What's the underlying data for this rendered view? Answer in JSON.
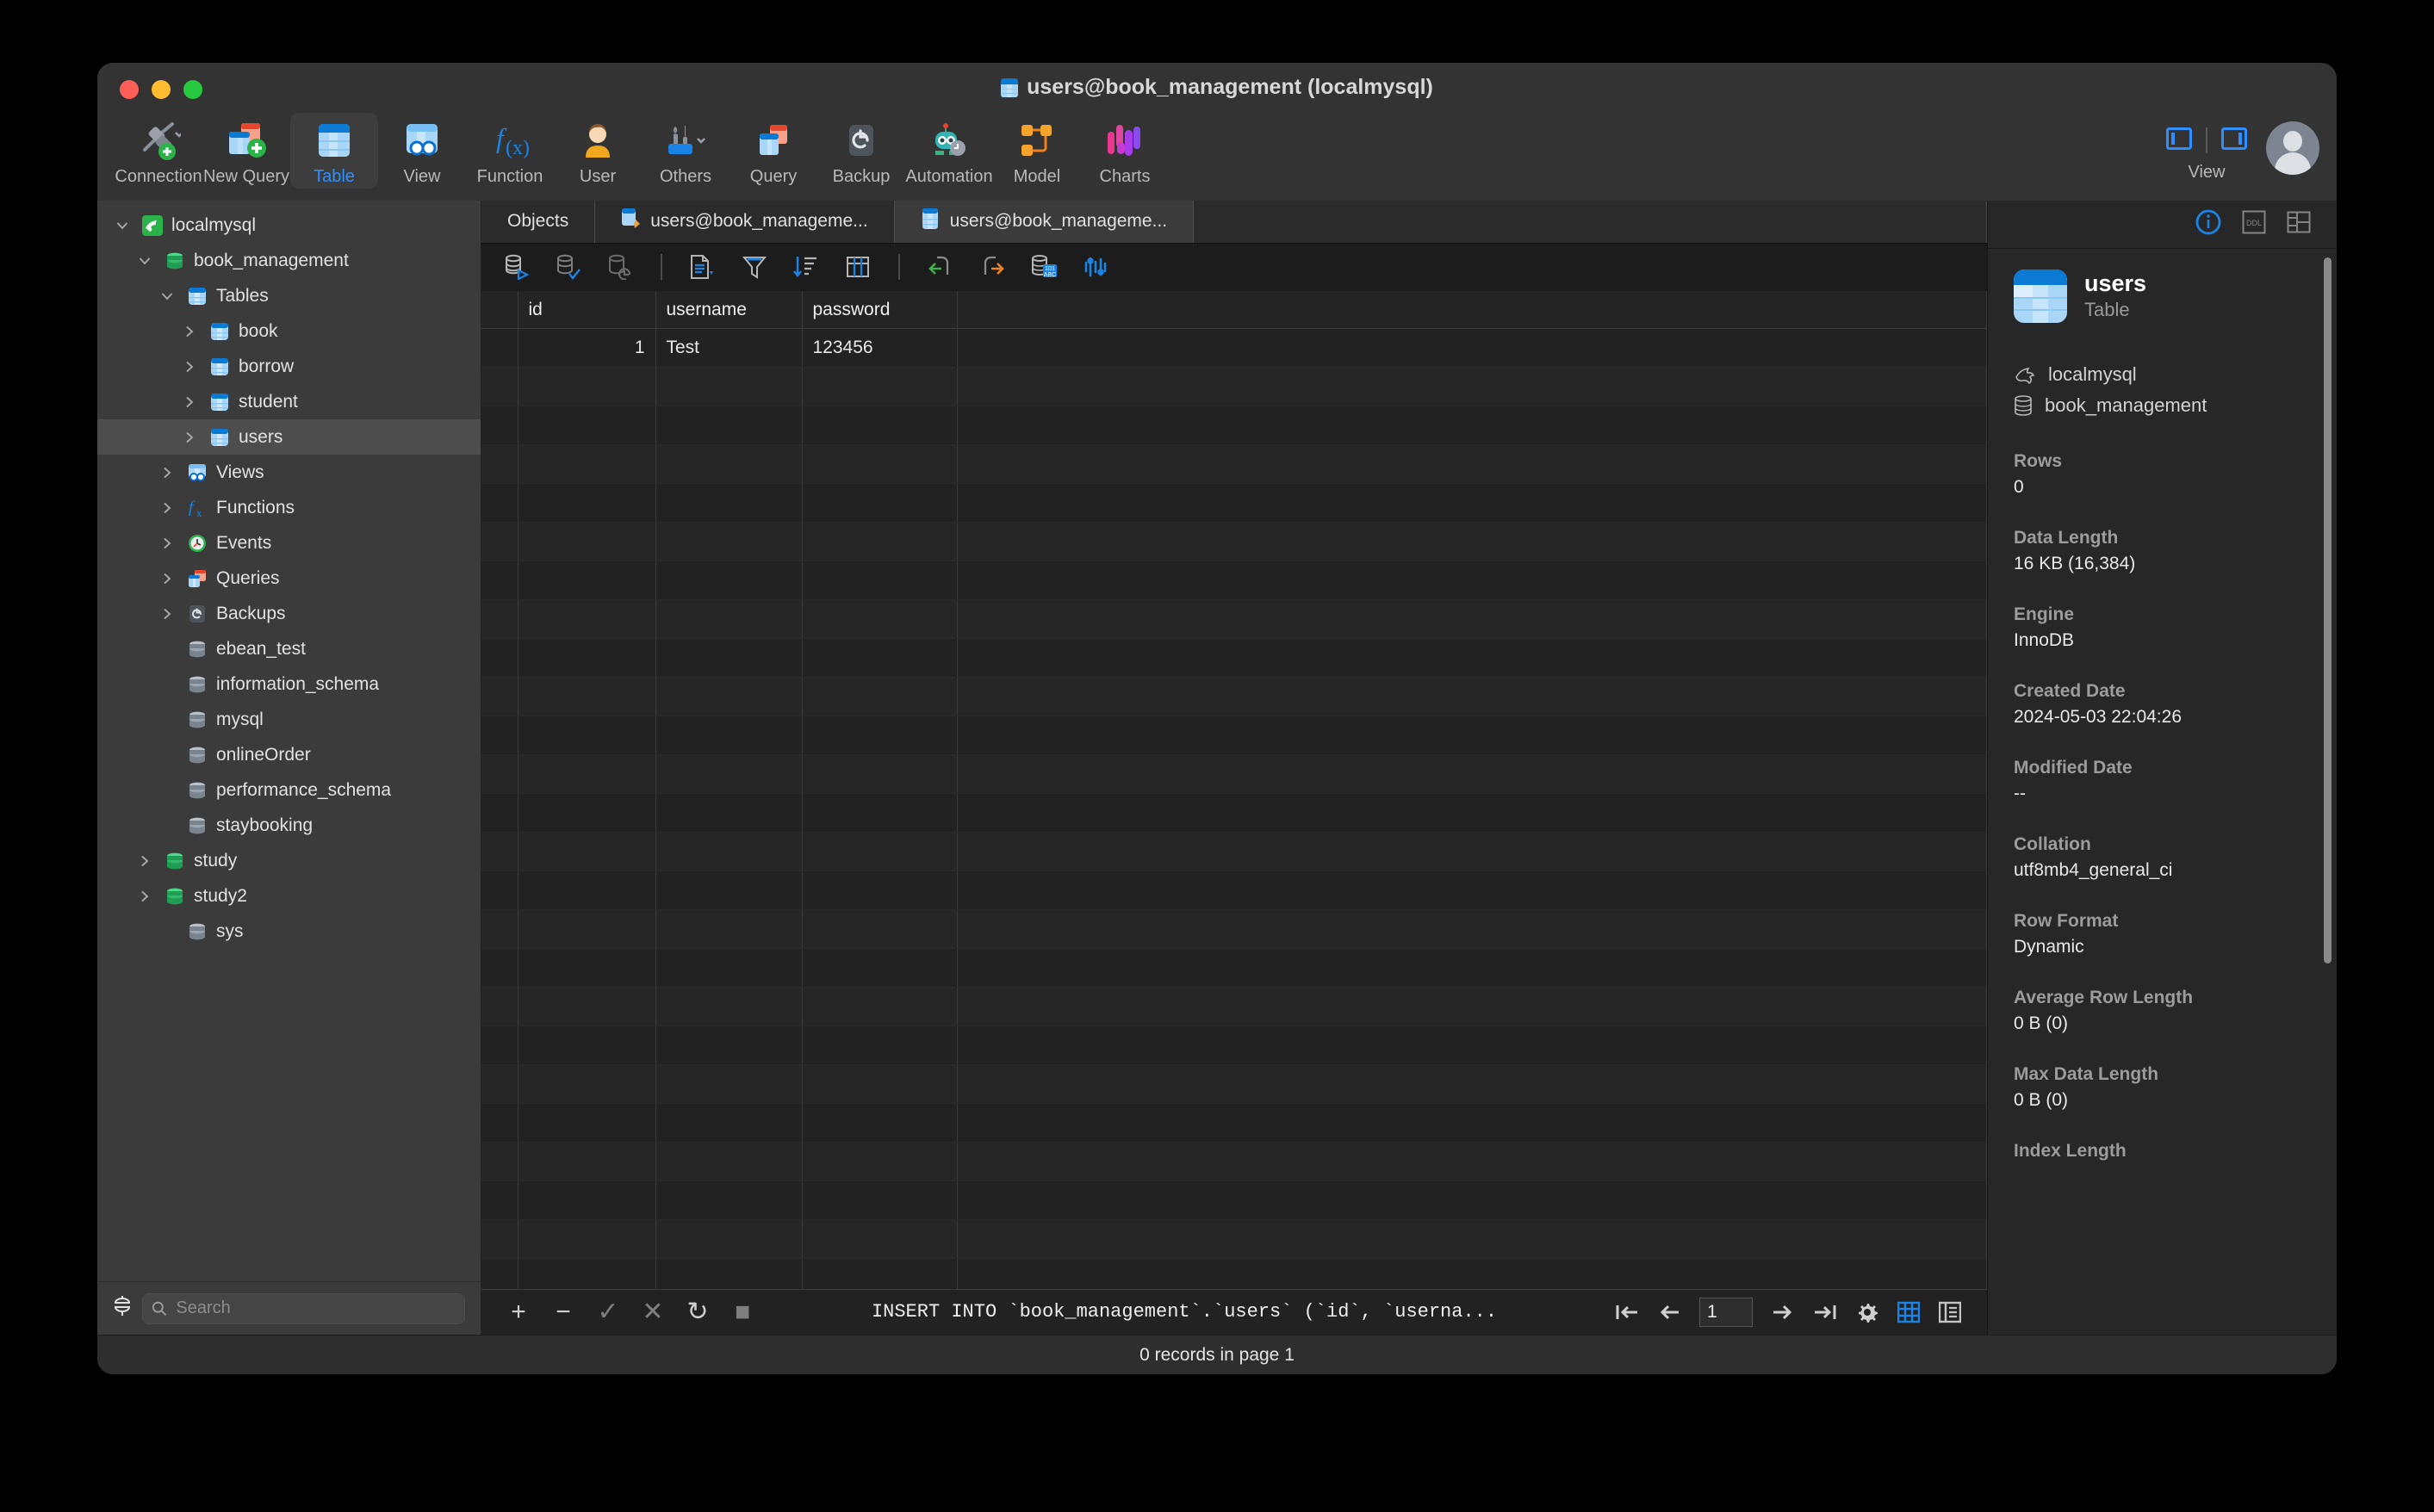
{
  "window": {
    "title": "users@book_management (localmysql)"
  },
  "toolbar": {
    "items": [
      {
        "label": "Connection",
        "icon": "connection-icon",
        "selected": false
      },
      {
        "label": "New Query",
        "icon": "new-query-icon",
        "selected": false
      },
      {
        "label": "Table",
        "icon": "table-icon",
        "selected": true
      },
      {
        "label": "View",
        "icon": "view-icon",
        "selected": false
      },
      {
        "label": "Function",
        "icon": "function-icon",
        "selected": false
      },
      {
        "label": "User",
        "icon": "user-icon",
        "selected": false
      },
      {
        "label": "Others",
        "icon": "others-icon",
        "selected": false
      },
      {
        "label": "Query",
        "icon": "query-icon",
        "selected": false
      },
      {
        "label": "Backup",
        "icon": "backup-icon",
        "selected": false
      },
      {
        "label": "Automation",
        "icon": "automation-icon",
        "selected": false
      },
      {
        "label": "Model",
        "icon": "model-icon",
        "selected": false
      },
      {
        "label": "Charts",
        "icon": "charts-icon",
        "selected": false
      }
    ],
    "view_label": "View"
  },
  "sidebar": {
    "search_placeholder": "Search",
    "search_value": "",
    "tree": [
      {
        "label": "localmysql",
        "indent": 0,
        "chev": "down",
        "icon": "dolphin-icon",
        "selected": false
      },
      {
        "label": "book_management",
        "indent": 1,
        "chev": "down",
        "icon": "database-green-icon",
        "selected": false
      },
      {
        "label": "Tables",
        "indent": 2,
        "chev": "down",
        "icon": "tables-icon",
        "selected": false
      },
      {
        "label": "book",
        "indent": 3,
        "chev": "right",
        "icon": "table-icon",
        "selected": false
      },
      {
        "label": "borrow",
        "indent": 3,
        "chev": "right",
        "icon": "table-icon",
        "selected": false
      },
      {
        "label": "student",
        "indent": 3,
        "chev": "right",
        "icon": "table-icon",
        "selected": false
      },
      {
        "label": "users",
        "indent": 3,
        "chev": "right",
        "icon": "table-icon",
        "selected": true
      },
      {
        "label": "Views",
        "indent": 2,
        "chev": "right",
        "icon": "views-icon",
        "selected": false
      },
      {
        "label": "Functions",
        "indent": 2,
        "chev": "right",
        "icon": "function-icon",
        "selected": false
      },
      {
        "label": "Events",
        "indent": 2,
        "chev": "right",
        "icon": "events-icon",
        "selected": false
      },
      {
        "label": "Queries",
        "indent": 2,
        "chev": "right",
        "icon": "queries-icon",
        "selected": false
      },
      {
        "label": "Backups",
        "indent": 2,
        "chev": "right",
        "icon": "backup-icon",
        "selected": false
      },
      {
        "label": "ebean_test",
        "indent": 2,
        "chev": "none",
        "icon": "database-gray-icon",
        "selected": false
      },
      {
        "label": "information_schema",
        "indent": 2,
        "chev": "none",
        "icon": "database-gray-icon",
        "selected": false
      },
      {
        "label": "mysql",
        "indent": 2,
        "chev": "none",
        "icon": "database-gray-icon",
        "selected": false
      },
      {
        "label": "onlineOrder",
        "indent": 2,
        "chev": "none",
        "icon": "database-gray-icon",
        "selected": false
      },
      {
        "label": "performance_schema",
        "indent": 2,
        "chev": "none",
        "icon": "database-gray-icon",
        "selected": false
      },
      {
        "label": "staybooking",
        "indent": 2,
        "chev": "none",
        "icon": "database-gray-icon",
        "selected": false
      },
      {
        "label": "study",
        "indent": 1,
        "chev": "right",
        "icon": "database-green-icon",
        "selected": false
      },
      {
        "label": "study2",
        "indent": 1,
        "chev": "right",
        "icon": "database-green-icon",
        "selected": false
      },
      {
        "label": "sys",
        "indent": 2,
        "chev": "none",
        "icon": "database-gray-icon",
        "selected": false
      }
    ]
  },
  "tabs": [
    {
      "label": "Objects",
      "icon": "none",
      "active": false
    },
    {
      "label": "users@book_manageme...",
      "icon": "query-editor-icon",
      "active": false
    },
    {
      "label": "users@book_manageme...",
      "icon": "table-icon",
      "active": true
    }
  ],
  "grid_toolbar": [
    {
      "name": "run-query-icon"
    },
    {
      "name": "commit-icon"
    },
    {
      "name": "rollback-icon"
    },
    {
      "name": "export-wizard-icon"
    },
    {
      "name": "filter-icon"
    },
    {
      "name": "sort-icon"
    },
    {
      "name": "columns-icon"
    },
    {
      "name": "undo-icon"
    },
    {
      "name": "redo-icon"
    },
    {
      "name": "data-generation-icon"
    },
    {
      "name": "profile-icon"
    }
  ],
  "grid": {
    "columns": [
      "id",
      "username",
      "password"
    ],
    "rows": [
      {
        "id": "1",
        "username": "Test",
        "password": "123456"
      }
    ],
    "empty_row_count": 27
  },
  "statusbar": {
    "add_label": "+",
    "remove_label": "−",
    "apply_label": "✓",
    "cancel_label": "✕",
    "refresh_label": "↻",
    "stop_label": "■",
    "sql": "INSERT INTO `book_management`.`users` (`id`, `userna...",
    "page_value": "1",
    "first_label": "|←",
    "prev_label": "←",
    "next_label": "→",
    "last_label": "→|",
    "settings_icon": "gear-icon",
    "grid_view_icon": "grid-view-icon",
    "form_view_icon": "form-view-icon"
  },
  "info_panel": {
    "header_icons": [
      {
        "name": "info-icon",
        "label": "i",
        "active": true
      },
      {
        "name": "ddl-icon",
        "label": "DDL",
        "active": false
      },
      {
        "name": "columns-panel-icon",
        "label": "",
        "active": false
      }
    ],
    "object_name": "users",
    "object_type": "Table",
    "connection": "localmysql",
    "database": "book_management",
    "properties": [
      {
        "key": "Rows",
        "value": "0"
      },
      {
        "key": "Data Length",
        "value": "16 KB (16,384)"
      },
      {
        "key": "Engine",
        "value": "InnoDB"
      },
      {
        "key": "Created Date",
        "value": "2024-05-03 22:04:26"
      },
      {
        "key": "Modified Date",
        "value": "--"
      },
      {
        "key": "Collation",
        "value": "utf8mb4_general_ci"
      },
      {
        "key": "Row Format",
        "value": "Dynamic"
      },
      {
        "key": "Average Row Length",
        "value": "0 B (0)"
      },
      {
        "key": "Max Data Length",
        "value": "0 B (0)"
      },
      {
        "key": "Index Length",
        "value": ""
      }
    ]
  },
  "footer": {
    "status": "0 records in page 1"
  },
  "colors": {
    "accent": "#2f8fff",
    "window_chrome": "#333333",
    "sidebar": "#3b3b3b",
    "grid_bg": "#222222",
    "info_bg": "#272727"
  }
}
